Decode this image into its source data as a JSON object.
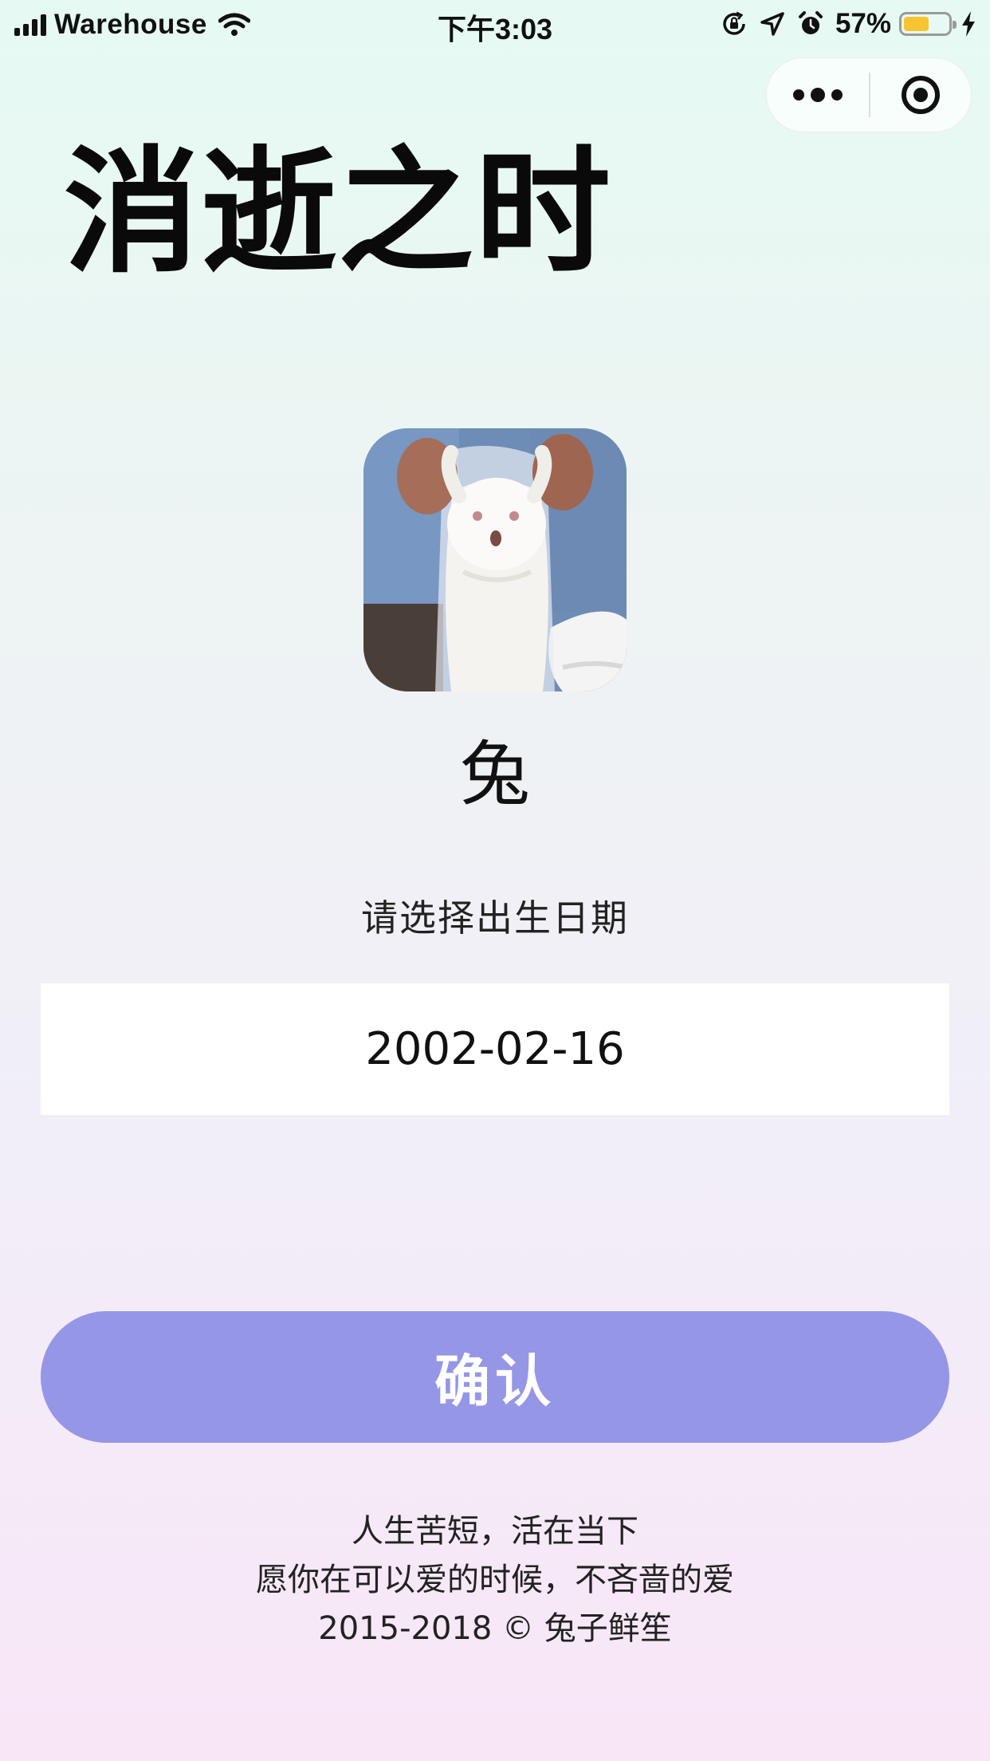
{
  "status_bar": {
    "carrier": "Warehouse",
    "time": "下午3:03",
    "battery_percent": "57%",
    "battery_level": 0.57,
    "icons": [
      "signal-icon",
      "wifi-icon",
      "orientation-lock-icon",
      "location-icon",
      "alarm-icon",
      "battery-icon",
      "charging-icon"
    ]
  },
  "capsule": {
    "more_icon": "more-dots-icon",
    "close_icon": "target-icon"
  },
  "title": "消逝之时",
  "avatar": {
    "description_icon": "rabbit-photo"
  },
  "zodiac": "兔",
  "date_prompt": "请选择出生日期",
  "date_picker": {
    "value": "2002-02-16"
  },
  "confirm_label": "确认",
  "footer": {
    "line1": "人生苦短，活在当下",
    "line2": "愿你在可以爱的时候，不吝啬的爱",
    "line3": "2015-2018 © 兔子鲜笙"
  },
  "colors": {
    "button": "#9696e7",
    "battery": "#f7c531",
    "background_top": "#e6faf3",
    "background_bottom": "#f8e6f7"
  }
}
